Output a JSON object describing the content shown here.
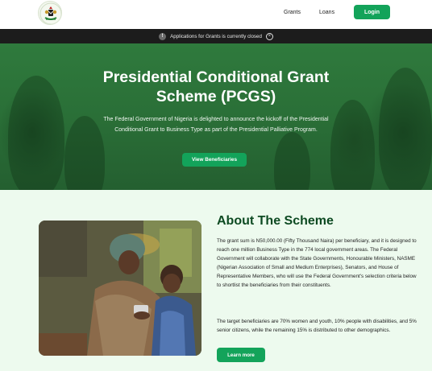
{
  "nav": {
    "links": [
      "Grants",
      "Loans"
    ],
    "login_label": "Login",
    "logo_icon": "coat-of-arms-icon"
  },
  "banner": {
    "info_symbol": "!",
    "text": "Applications for Grants is currently closed",
    "close_symbol": "×"
  },
  "hero": {
    "title": "Presidential Conditional Grant Scheme (PCGS)",
    "description": "The Federal Government of Nigeria is delighted to announce the kickoff of the Presidential Conditional Grant to Business Type as part of the Presidential Palliative Program.",
    "button_label": "View Beneficiaries"
  },
  "about": {
    "title": "About The Scheme",
    "paragraph_1": "The grant sum is N50,000.00 (Fifty Thousand Naira) per beneficiary, and it is designed to reach one million Business Type in the 774 local government areas. The Federal Government will collaborate with the State Governments, Honourable Ministers, NASME (Nigerian Association of Small and Medium Enterprises), Senators, and House of Representative Members, who will use the Federal Government's selection criteria below to shortlist the beneficiaries from their constituents.",
    "paragraph_2": "The target beneficiaries are 70% women and youth, 10% people with disabilities, and 5% senior citizens, while the remaining 15% is distributed to other demographics.",
    "button_label": "Learn more"
  },
  "colors": {
    "accent": "#13a35a",
    "hero_green": "#2a6f37",
    "banner_bg": "#1c1c1c",
    "about_bg": "#edfaee",
    "heading_green": "#0d4a22"
  }
}
